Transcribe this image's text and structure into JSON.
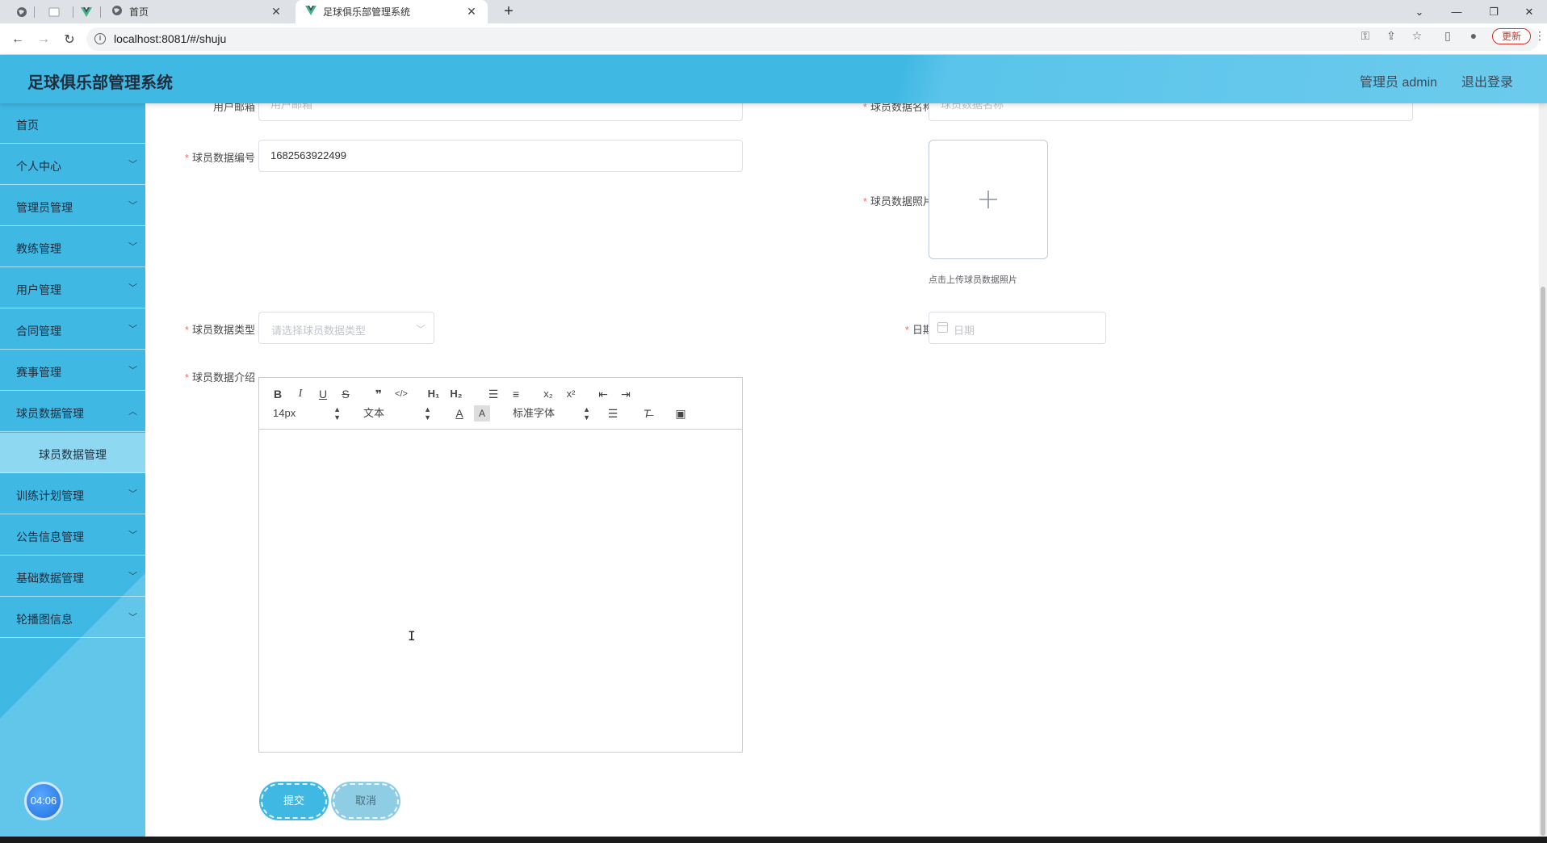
{
  "browser": {
    "tabs": [
      {
        "title": "首页",
        "active": false
      },
      {
        "title": "足球俱乐部管理系统",
        "active": true
      }
    ],
    "url": "localhost:8081/#/shuju",
    "update_label": "更新"
  },
  "header": {
    "title": "足球俱乐部管理系统",
    "user": "管理员 admin",
    "logout": "退出登录"
  },
  "sidebar": {
    "items": [
      {
        "label": "首页",
        "has_children": false
      },
      {
        "label": "个人中心",
        "has_children": true
      },
      {
        "label": "管理员管理",
        "has_children": true
      },
      {
        "label": "教练管理",
        "has_children": true
      },
      {
        "label": "用户管理",
        "has_children": true
      },
      {
        "label": "合同管理",
        "has_children": true
      },
      {
        "label": "赛事管理",
        "has_children": true
      },
      {
        "label": "球员数据管理",
        "has_children": true
      },
      {
        "label": "训练计划管理",
        "has_children": true
      },
      {
        "label": "公告信息管理",
        "has_children": true
      },
      {
        "label": "基础数据管理",
        "has_children": true
      },
      {
        "label": "轮播图信息",
        "has_children": true
      }
    ],
    "submenu_active": "球员数据管理",
    "timer": "04:06"
  },
  "form": {
    "email": {
      "label": "用户邮箱",
      "placeholder": "用户邮箱"
    },
    "name": {
      "label": "球员数据名称",
      "placeholder": "球员数据名称"
    },
    "uuid": {
      "label": "球员数据编号",
      "value": "1682563922499"
    },
    "photo": {
      "label": "球员数据照片",
      "tip": "点击上传球员数据照片"
    },
    "type": {
      "label": "球员数据类型",
      "placeholder": "请选择球员数据类型"
    },
    "date": {
      "label": "日期",
      "placeholder": "日期"
    },
    "intro": {
      "label": "球员数据介绍"
    },
    "editor": {
      "font_size": "14px",
      "header": "文本",
      "font_family": "标准字体"
    },
    "submit": "提交",
    "cancel": "取消"
  },
  "colors": {
    "primary": "#3fb8e4",
    "required": "#f56c6c",
    "placeholder": "#c0c4cc"
  }
}
